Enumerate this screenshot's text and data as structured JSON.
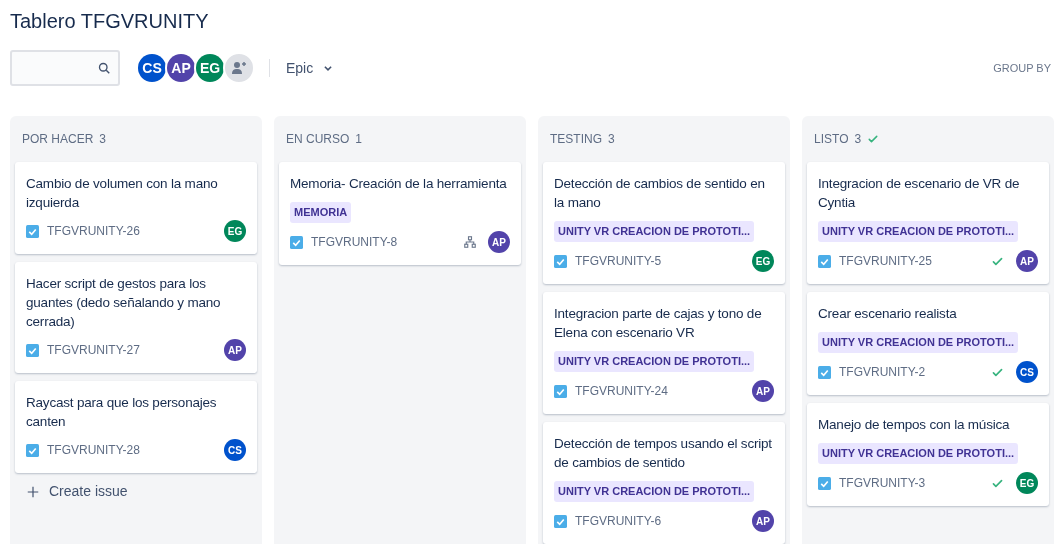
{
  "title": "Tablero TFGVRUNITY",
  "toolbar": {
    "avatars": [
      {
        "initials": "CS",
        "color": "#0052cc"
      },
      {
        "initials": "AP",
        "color": "#5243aa"
      },
      {
        "initials": "EG",
        "color": "#00875a"
      }
    ],
    "filter": "Epic",
    "group_by": "GROUP BY"
  },
  "columns": [
    {
      "name": "POR HACER",
      "count": "3",
      "done": false,
      "create_issue": "Create issue",
      "cards": [
        {
          "title": "Cambio de volumen con la mano izquierda",
          "key": "TFGVRUNITY-26",
          "assignee": {
            "initials": "EG",
            "color": "#00875a"
          },
          "resolved": false,
          "has_children": false
        },
        {
          "title": "Hacer script de gestos para los guantes (dedo señalando y mano cerrada)",
          "key": "TFGVRUNITY-27",
          "assignee": {
            "initials": "AP",
            "color": "#5243aa"
          },
          "resolved": false,
          "has_children": false
        },
        {
          "title": "Raycast para que los personajes canten",
          "key": "TFGVRUNITY-28",
          "assignee": {
            "initials": "CS",
            "color": "#0052cc"
          },
          "resolved": false,
          "has_children": false
        }
      ]
    },
    {
      "name": "EN CURSO",
      "count": "1",
      "done": false,
      "cards": [
        {
          "title": "Memoria- Creación de la herramienta",
          "epic": "MEMORIA",
          "key": "TFGVRUNITY-8",
          "assignee": {
            "initials": "AP",
            "color": "#5243aa"
          },
          "resolved": false,
          "has_children": true
        }
      ]
    },
    {
      "name": "TESTING",
      "count": "3",
      "done": false,
      "cards": [
        {
          "title": "Detección de cambios de sentido en la mano",
          "epic": "UNITY VR CREACION DE PROTOTI...",
          "key": "TFGVRUNITY-5",
          "assignee": {
            "initials": "EG",
            "color": "#00875a"
          },
          "resolved": false,
          "has_children": false
        },
        {
          "title": "Integracion parte de cajas y tono de Elena con escenario VR",
          "epic": "UNITY VR CREACION DE PROTOTI...",
          "key": "TFGVRUNITY-24",
          "assignee": {
            "initials": "AP",
            "color": "#5243aa"
          },
          "resolved": false,
          "has_children": false
        },
        {
          "title": "Detección de tempos usando el script de cambios de sentido",
          "epic": "UNITY VR CREACION DE PROTOTI...",
          "key": "TFGVRUNITY-6",
          "assignee": {
            "initials": "AP",
            "color": "#5243aa"
          },
          "resolved": false,
          "has_children": false
        }
      ]
    },
    {
      "name": "LISTO",
      "count": "3",
      "done": true,
      "cards": [
        {
          "title": "Integracion de escenario de VR de Cyntia",
          "epic": "UNITY VR CREACION DE PROTOTI...",
          "key": "TFGVRUNITY-25",
          "assignee": {
            "initials": "AP",
            "color": "#5243aa"
          },
          "resolved": true,
          "has_children": false
        },
        {
          "title": "Crear escenario realista",
          "epic": "UNITY VR CREACION DE PROTOTI...",
          "key": "TFGVRUNITY-2",
          "assignee": {
            "initials": "CS",
            "color": "#0052cc"
          },
          "resolved": true,
          "has_children": false
        },
        {
          "title": "Manejo de tempos con la música",
          "epic": "UNITY VR CREACION DE PROTOTI...",
          "key": "TFGVRUNITY-3",
          "assignee": {
            "initials": "EG",
            "color": "#00875a"
          },
          "resolved": true,
          "has_children": false
        }
      ]
    }
  ]
}
